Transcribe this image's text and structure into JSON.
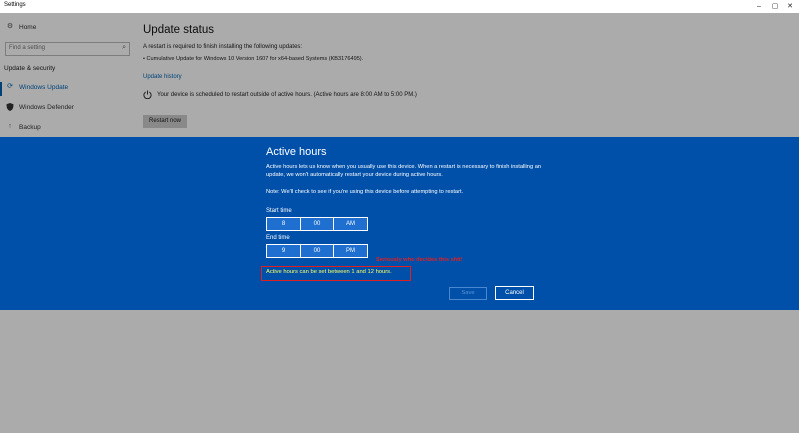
{
  "window": {
    "title": "Settings",
    "controls": {
      "minimize": "–",
      "maximize": "▢",
      "close": "✕"
    }
  },
  "sidebar": {
    "home": {
      "label": "Home",
      "icon": "gear-icon"
    },
    "search": {
      "placeholder": "Find a setting"
    },
    "category": "Update & security",
    "items": [
      {
        "label": "Windows Update",
        "icon": "refresh-icon",
        "active": true
      },
      {
        "label": "Windows Defender",
        "icon": "shield-icon"
      },
      {
        "label": "Backup",
        "icon": "backup-icon"
      }
    ]
  },
  "main": {
    "title": "Update status",
    "restart_required": "A restart is required to finish installing the following updates:",
    "update_item": "• Cumulative Update for Windows 10 Version 1607 for x64-based Systems (KB3176495).",
    "update_history_link": "Update history",
    "scheduled_text": "Your device is scheduled to restart outside of active hours. (Active hours are 8:00 AM to 5:00 PM.)",
    "restart_now_label": "Restart now"
  },
  "dialog": {
    "title": "Active hours",
    "description": "Active hours lets us know when you usually use this device. When a restart is necessary to finish installing an update, we won't automatically restart your device during active hours.",
    "note": "Note: We'll check to see if you're using this device before attempting to restart.",
    "start_time": {
      "label": "Start time",
      "hour": "8",
      "minute": "00",
      "period": "AM"
    },
    "end_time": {
      "label": "End time",
      "hour": "9",
      "minute": "00",
      "period": "PM"
    },
    "validation": "Active hours can be set between 1 and 12 hours.",
    "save_label": "Save",
    "cancel_label": "Cancel"
  },
  "annotation": {
    "text": "Seriously who decides this shit!",
    "color": "#e02020"
  },
  "colors": {
    "dialog_bg": "#0050aa",
    "accent": "#0063b1",
    "validation_text": "#ffff66"
  }
}
